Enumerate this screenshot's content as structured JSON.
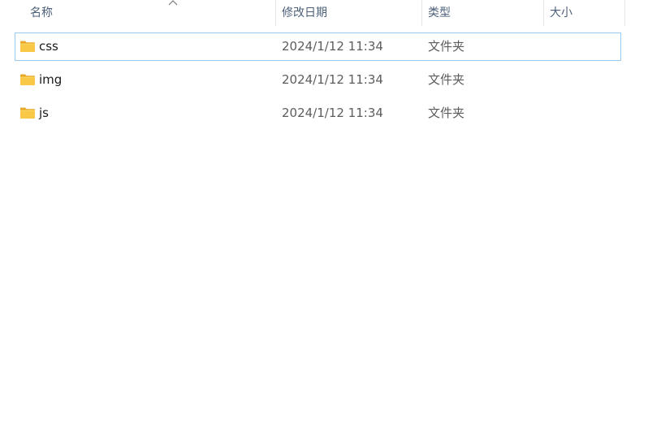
{
  "columns": {
    "name": "名称",
    "date": "修改日期",
    "type": "类型",
    "size": "大小"
  },
  "sort": {
    "column": "name",
    "direction": "ascending",
    "icon": "chevron-up-icon"
  },
  "colors": {
    "folder_body": "#f8c846",
    "folder_tab": "#e8a92a",
    "focus_border": "#99c9ef",
    "header_text": "#4c607a"
  },
  "files": [
    {
      "name": "css",
      "date": "2024/1/12 11:34",
      "type": "文件夹",
      "size": "",
      "icon": "folder-icon",
      "focused": true
    },
    {
      "name": "img",
      "date": "2024/1/12 11:34",
      "type": "文件夹",
      "size": "",
      "icon": "folder-icon",
      "focused": false
    },
    {
      "name": "js",
      "date": "2024/1/12 11:34",
      "type": "文件夹",
      "size": "",
      "icon": "folder-icon",
      "focused": false
    }
  ]
}
